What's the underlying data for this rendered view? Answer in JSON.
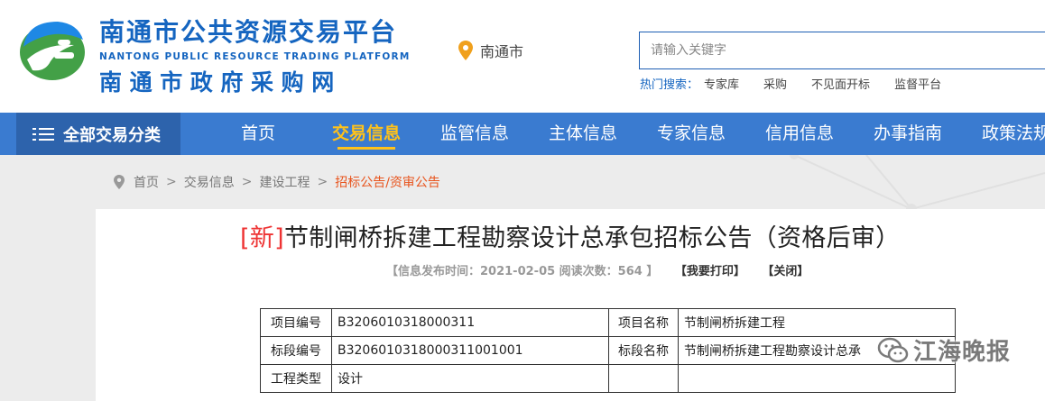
{
  "header": {
    "logo_title": "南通市公共资源交易平台",
    "logo_en": "NANTONG PUBLIC RESOURCE TRADING PLATFORM",
    "logo_sub": "南通市政府采购网",
    "location": "南通市",
    "search_placeholder": "请输入关键字",
    "hot_label": "热门搜索：",
    "hot_items": [
      "专家库",
      "采购",
      "不见面开标",
      "监督平台"
    ]
  },
  "nav": {
    "all_label": "全部交易分类",
    "items": [
      "首页",
      "交易信息",
      "监管信息",
      "主体信息",
      "专家信息",
      "信用信息",
      "办事指南",
      "政策法规"
    ],
    "active_index": 1
  },
  "breadcrumb": {
    "items": [
      "首页",
      "交易信息",
      "建设工程"
    ],
    "separator": ">",
    "current": "招标公告/资审公告"
  },
  "article": {
    "new_tag": "[新]",
    "title": "节制闸桥拆建工程勘察设计总承包招标公告（资格后审）",
    "meta": "【信息发布时间：2021-02-05 阅读次数：564 】",
    "print": "【我要打印】",
    "close": "【关闭】"
  },
  "table": {
    "rows": [
      [
        "项目编号",
        "B3206010318000311",
        "项目名称",
        "节制闸桥拆建工程"
      ],
      [
        "标段编号",
        "B3206010318000311001001",
        "标段名称",
        "节制闸桥拆建工程勘察设计总承"
      ],
      [
        "工程类型",
        "设计",
        "",
        ""
      ]
    ]
  },
  "watermark": "江海晚报",
  "colors": {
    "brand_blue": "#1565c0",
    "nav_bg": "#3a7bd0",
    "nav_all_bg": "#2d63ac",
    "active": "#ffc21a",
    "crumb_current": "#e8541d",
    "new_tag": "#e33333"
  },
  "icons": {
    "logo": "logo-mark-icon",
    "location": "location-pin-icon",
    "menu": "menu-list-icon",
    "breadcrumb": "breadcrumb-pin-icon",
    "watermark": "wechat-icon"
  }
}
